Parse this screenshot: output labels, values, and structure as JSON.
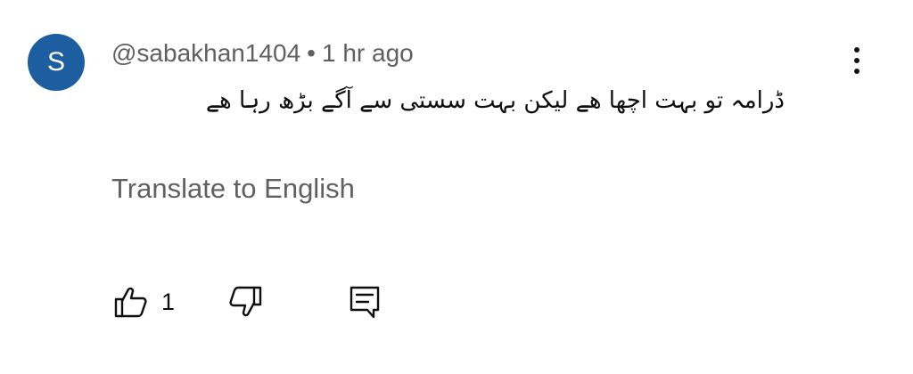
{
  "comment": {
    "avatar_letter": "S",
    "avatar_color": "#1c5ea0",
    "author": "@sabakhan1404",
    "separator": "•",
    "timestamp": "1 hr ago",
    "text": "ڈرامہ تو بہت اچھا ھے لیکن بہت سستی سے آگے بڑھ رہا ھے",
    "translate_label": "Translate to English",
    "like_count": "1"
  },
  "icons": {
    "more": "more-vertical-icon",
    "like": "thumbs-up-icon",
    "dislike": "thumbs-down-icon",
    "reply": "comment-reply-icon"
  },
  "colors": {
    "secondary_text": "#606060",
    "primary_text": "#0f0f0f"
  }
}
